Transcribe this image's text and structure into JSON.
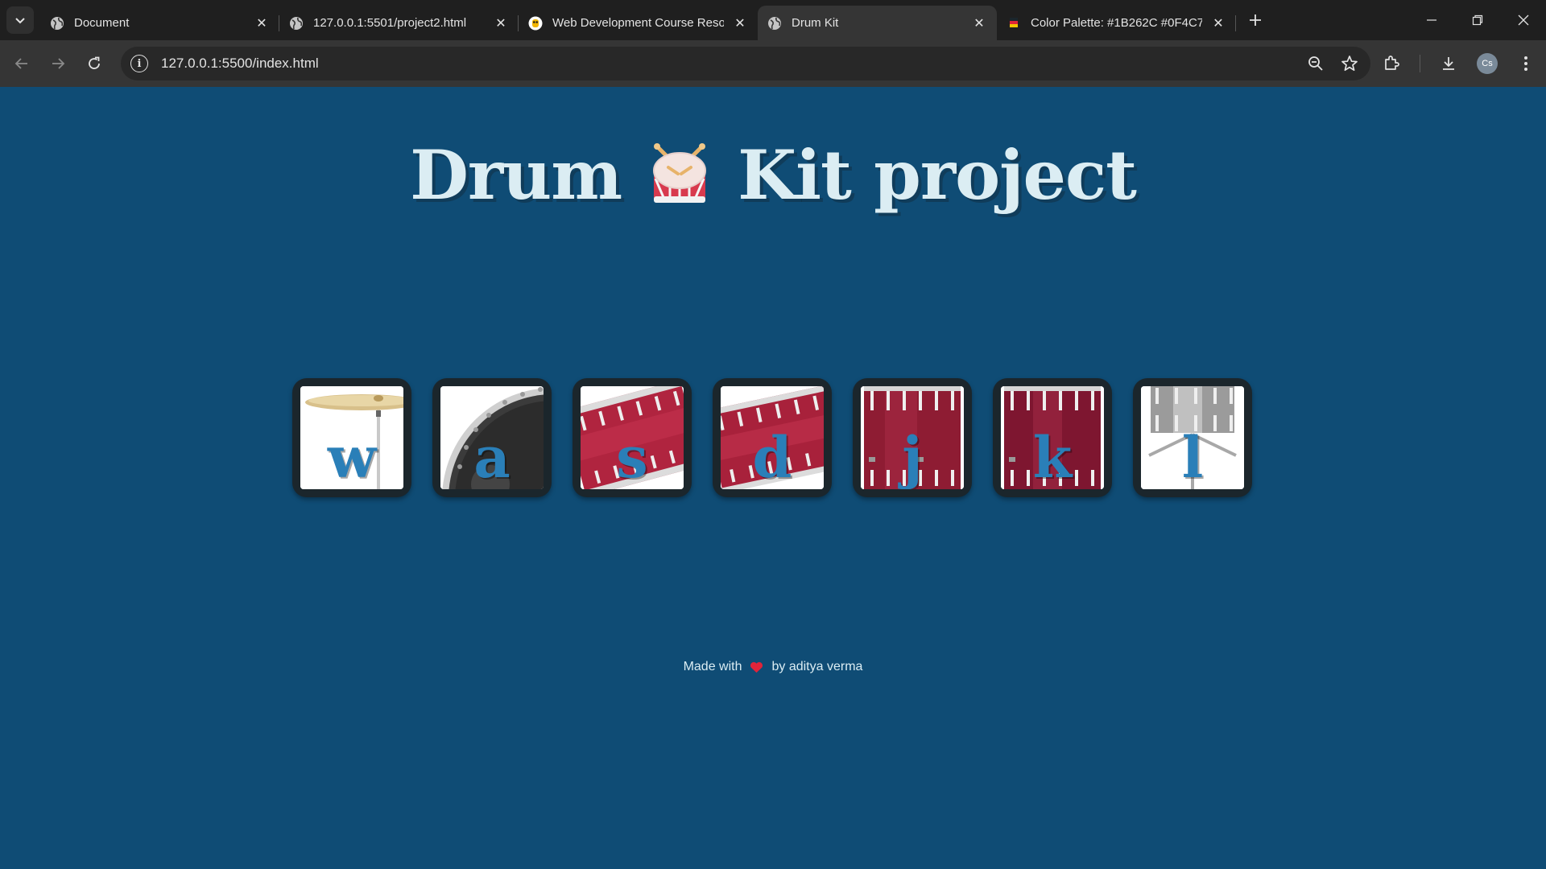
{
  "browser": {
    "tabs": [
      {
        "title": "Document",
        "favicon": "globe-icon",
        "active": false
      },
      {
        "title": "127.0.0.1:5501/project2.html",
        "favicon": "globe-icon",
        "active": false
      },
      {
        "title": "Web Development Course Reso",
        "favicon": "owl-icon",
        "active": false
      },
      {
        "title": "Drum Kit",
        "favicon": "globe-icon",
        "active": true
      },
      {
        "title": "Color Palette: #1B262C #0F4C7",
        "favicon": "palette-icon",
        "active": false
      }
    ],
    "url": "127.0.0.1:5500/index.html",
    "profile_initials": "Cs"
  },
  "page": {
    "title_left": "Drum",
    "title_right": "Kit project",
    "drums": [
      {
        "key": "w",
        "image": "crash-cymbal"
      },
      {
        "key": "a",
        "image": "kick-drum"
      },
      {
        "key": "s",
        "image": "snare-drum"
      },
      {
        "key": "d",
        "image": "tom-1"
      },
      {
        "key": "j",
        "image": "tom-2"
      },
      {
        "key": "k",
        "image": "tom-3"
      },
      {
        "key": "l",
        "image": "tom-4"
      }
    ],
    "footer_prefix": "Made with",
    "footer_suffix": "by aditya verma",
    "footer_icon": "heart-icon"
  },
  "colors": {
    "background": "#0F4C75",
    "heading": "#DBEDF3",
    "button_frame": "#1B262C",
    "letter": "#2A7FB8"
  }
}
